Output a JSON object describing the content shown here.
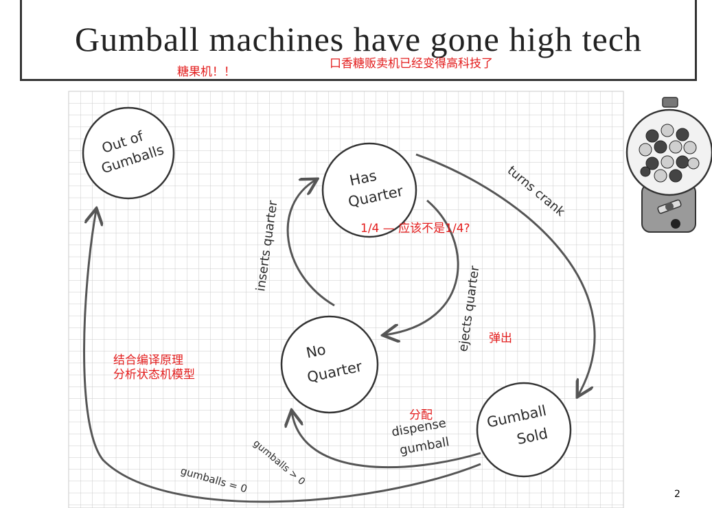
{
  "slide": {
    "title": "Gumball machines have gone high tech",
    "page_number": "2"
  },
  "notes": {
    "gumball_machine": "糖果机！！",
    "title_translation": "口香糖贩卖机已经变得高科技了",
    "quarter_question": "1/4 — 应该不是1/4?",
    "eject": "弹出",
    "compiler_line1": "结合编译原理",
    "compiler_line2": "分析状态机模型",
    "dispense": "分配"
  },
  "states": {
    "out_of_gumballs": [
      "Out of",
      "Gumballs"
    ],
    "has_quarter": [
      "Has",
      "Quarter"
    ],
    "no_quarter": [
      "No",
      "Quarter"
    ],
    "gumball_sold": [
      "Gumball",
      "Sold"
    ]
  },
  "transitions": {
    "inserts_quarter": "inserts quarter",
    "ejects_quarter": "ejects quarter",
    "turns_crank": "turns crank",
    "dispense_gumball": [
      "dispense",
      "gumball"
    ],
    "gumballs_gt_0": "gumballs > 0",
    "gumballs_eq_0": "gumballs = 0"
  },
  "colors": {
    "note": "#e31c1c",
    "ink": "#2a2a2a",
    "grid": "#c9c9c9"
  }
}
